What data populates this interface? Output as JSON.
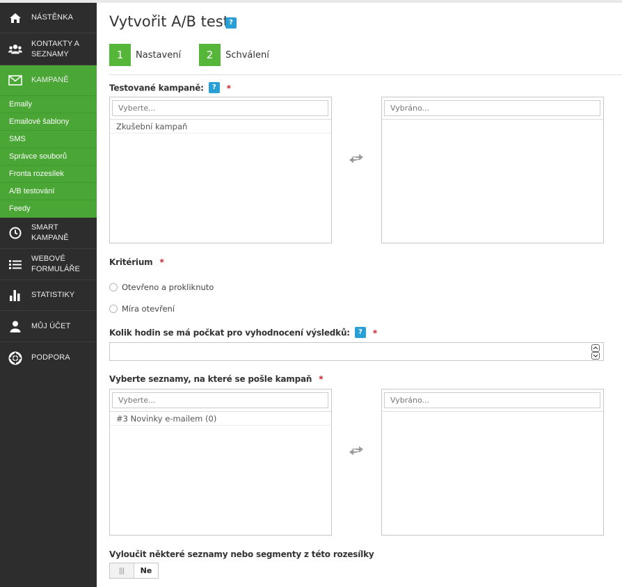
{
  "sidebar": {
    "items": [
      {
        "label": "NÁSTĚNKA",
        "icon": "home-icon"
      },
      {
        "label": "KONTAKTY A SEZNAMY",
        "icon": "users-icon"
      },
      {
        "label": "KAMPANĚ",
        "icon": "envelope-icon",
        "active": true
      },
      {
        "label": "SMART KAMPANĚ",
        "icon": "clock-icon"
      },
      {
        "label": "WEBOVÉ FORMULÁŘE",
        "icon": "list-icon"
      },
      {
        "label": "STATISTIKY",
        "icon": "bar-chart-icon"
      },
      {
        "label": "MŮJ ÚČET",
        "icon": "user-icon"
      },
      {
        "label": "PODPORA",
        "icon": "lifebuoy-icon"
      }
    ],
    "kampane_sub": [
      "Emaily",
      "Emailové šablony",
      "SMS",
      "Správce souborů",
      "Fronta rozesílek",
      "A/B testování",
      "Feedy"
    ]
  },
  "page": {
    "title": "Vytvořit A/B test",
    "help": "?"
  },
  "steps": [
    {
      "num": "1",
      "label": "Nastavení"
    },
    {
      "num": "2",
      "label": "Schválení"
    }
  ],
  "campaigns": {
    "label": "Testované kampaně:",
    "required": "*",
    "filter_placeholder": "Vyberte...",
    "selected_placeholder": "Vybráno...",
    "available": [
      "Zkušební kampaň"
    ]
  },
  "criterion": {
    "label": "Kritérium",
    "required": "*",
    "options": [
      "Otevřeno a prokliknuto",
      "Míra otevření"
    ]
  },
  "hours": {
    "label": "Kolik hodin se má počkat pro vyhodnocení výsledků:",
    "required": "*",
    "value": ""
  },
  "lists": {
    "label": "Vyberte seznamy, na které se pošle kampaň",
    "required": "*",
    "filter_placeholder": "Vyberte...",
    "selected_placeholder": "Vybráno...",
    "available": [
      "#3 Novinky e-mailem (0)"
    ]
  },
  "exclude": {
    "label": "Vyloučit některé seznamy nebo segmenty z této rozesílky",
    "toggle_value": "Ne"
  },
  "colors": {
    "sidebar_bg": "#2d2d2d",
    "accent_green": "#4aa635",
    "help_blue": "#2a9fd6",
    "required_red": "#cc2127"
  }
}
